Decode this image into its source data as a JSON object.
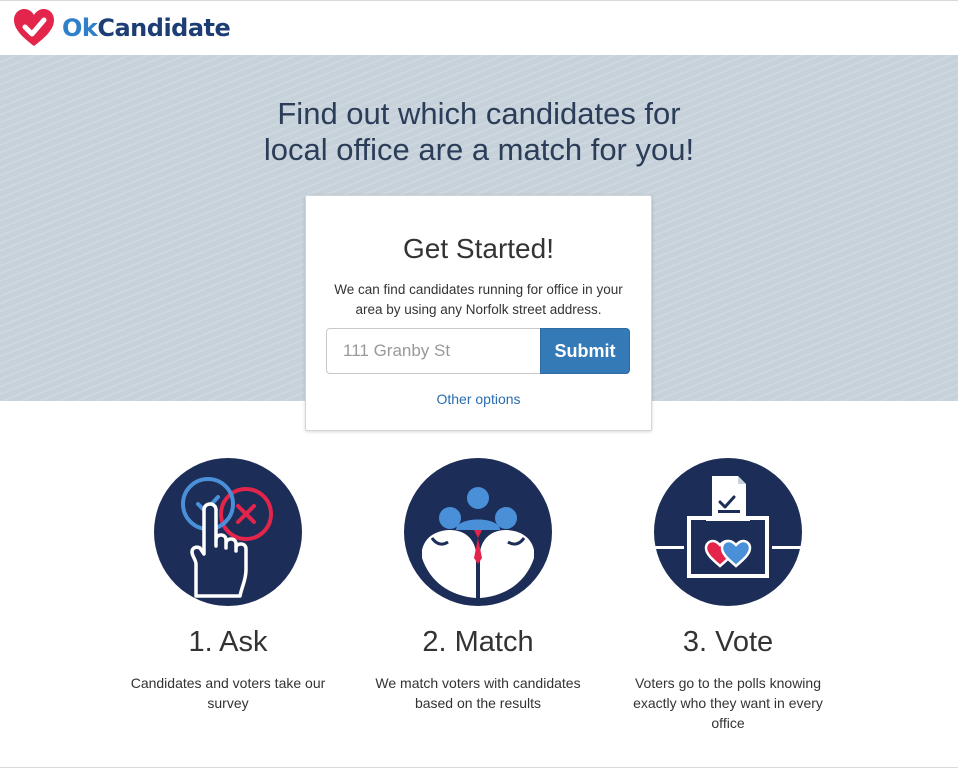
{
  "brand": {
    "name_part1": "Ok",
    "name_part2": "Candidate",
    "logo_icon": "heart-check-icon",
    "colors": {
      "heart": "#e4254b",
      "ok": "#2f7fc9",
      "candidate": "#1d3d75"
    }
  },
  "hero": {
    "title_line1": "Find out which candidates for",
    "title_line2": "local office are a match for you!",
    "background": "#c6d1da"
  },
  "get_started": {
    "title": "Get Started!",
    "description": "We can find candidates running for office in your area by using any Norfolk street address.",
    "address_placeholder": "111 Granby St",
    "address_value": "",
    "submit_label": "Submit",
    "other_options_label": "Other options",
    "submit_color": "#347ab7"
  },
  "steps": [
    {
      "title": "1. Ask",
      "description": "Candidates and voters take our survey",
      "icon": "ask-survey-icon"
    },
    {
      "title": "2. Match",
      "description": "We match voters with candidates based on the results",
      "icon": "match-people-icon"
    },
    {
      "title": "3. Vote",
      "description": "Voters go to the polls knowing exactly who they want in every office",
      "icon": "ballot-box-icon"
    }
  ],
  "colors": {
    "icon_circle": "#1c2d57",
    "accent_red": "#e4254b",
    "accent_blue": "#4a90d9"
  }
}
